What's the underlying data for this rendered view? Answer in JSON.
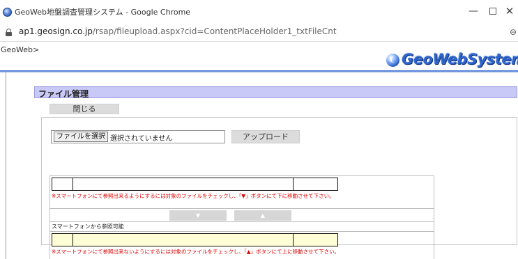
{
  "browser": {
    "window_title": "GeoWeb地盤調査管理システム - Google Chrome",
    "url_host": "ap1.geosign.co.jp",
    "url_path": "/rsap/fileupload.aspx?cid=ContentPlaceHolder1_txtFileCnt",
    "controls": {
      "minimize": "—",
      "maximize": "",
      "close": "✕"
    },
    "zoom_glyph": "⊖"
  },
  "header": {
    "breadcrumb": "GeoWeb>",
    "logo_text": "GeoWebSystem"
  },
  "panel": {
    "title": "ファイル管理",
    "close_button": "閉じる",
    "file_input": {
      "button_label": "ファイルを選択",
      "status_text": "選択されていません"
    },
    "upload_button": "アップロード",
    "section1_note": "※スマートフォンにて参照出来るようにするには対象のファイルをチェックし、「▼」ボタンにて下に移動させて下さい。",
    "move_down_button": "▼",
    "move_up_button": "▲",
    "section2_label": "スマートフォンから参照可能",
    "section2_note": "※スマートフォンにて参照出来ないようにするには対象のファイルをチェックし、「▲」ボタンにて上に移動させて下さい。"
  },
  "colors": {
    "panel_header_bg": "#c9c9f7",
    "note_text": "#e00000",
    "smartphone_row_bg": "#fefed6",
    "logo_blue": "#2f64c8"
  }
}
